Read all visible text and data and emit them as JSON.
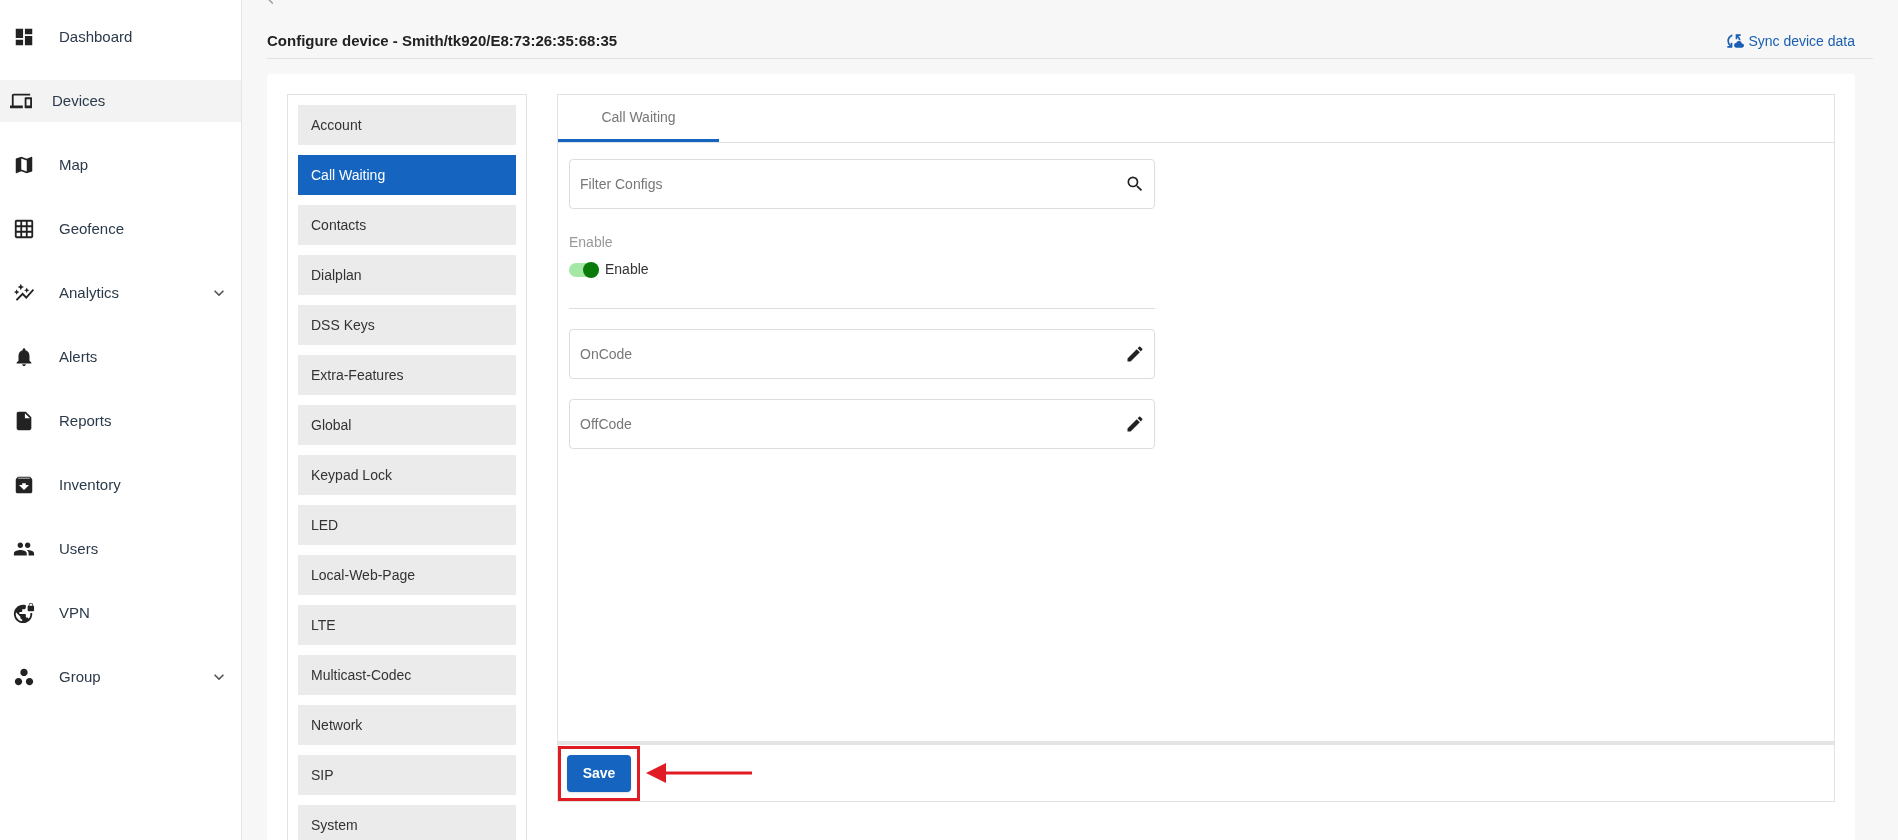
{
  "sidebar": {
    "items": [
      {
        "label": "Dashboard",
        "selected": false,
        "expandable": false
      },
      {
        "label": "Devices",
        "selected": true,
        "expandable": false
      },
      {
        "label": "Map",
        "selected": false,
        "expandable": false
      },
      {
        "label": "Geofence",
        "selected": false,
        "expandable": false
      },
      {
        "label": "Analytics",
        "selected": false,
        "expandable": true
      },
      {
        "label": "Alerts",
        "selected": false,
        "expandable": false
      },
      {
        "label": "Reports",
        "selected": false,
        "expandable": false
      },
      {
        "label": "Inventory",
        "selected": false,
        "expandable": false
      },
      {
        "label": "Users",
        "selected": false,
        "expandable": false
      },
      {
        "label": "VPN",
        "selected": false,
        "expandable": false
      },
      {
        "label": "Group",
        "selected": false,
        "expandable": true
      }
    ]
  },
  "header": {
    "title": "Configure device - Smith/tk920/E8:73:26:35:68:35",
    "sync_link": "Sync device data"
  },
  "config_menu": {
    "items": [
      {
        "label": "Account",
        "selected": false
      },
      {
        "label": "Call Waiting",
        "selected": true
      },
      {
        "label": "Contacts",
        "selected": false
      },
      {
        "label": "Dialplan",
        "selected": false
      },
      {
        "label": "DSS Keys",
        "selected": false
      },
      {
        "label": "Extra-Features",
        "selected": false
      },
      {
        "label": "Global",
        "selected": false
      },
      {
        "label": "Keypad Lock",
        "selected": false
      },
      {
        "label": "LED",
        "selected": false
      },
      {
        "label": "Local-Web-Page",
        "selected": false
      },
      {
        "label": "LTE",
        "selected": false
      },
      {
        "label": "Multicast-Codec",
        "selected": false
      },
      {
        "label": "Network",
        "selected": false
      },
      {
        "label": "SIP",
        "selected": false
      },
      {
        "label": "System",
        "selected": false
      }
    ]
  },
  "tabs": [
    {
      "label": "Call Waiting",
      "selected": true
    }
  ],
  "filter": {
    "placeholder": "Filter Configs"
  },
  "enable": {
    "label": "Enable",
    "toggle_label": "Enable",
    "on": true
  },
  "fields": [
    {
      "placeholder": "OnCode"
    },
    {
      "placeholder": "OffCode"
    }
  ],
  "save_button": "Save"
}
